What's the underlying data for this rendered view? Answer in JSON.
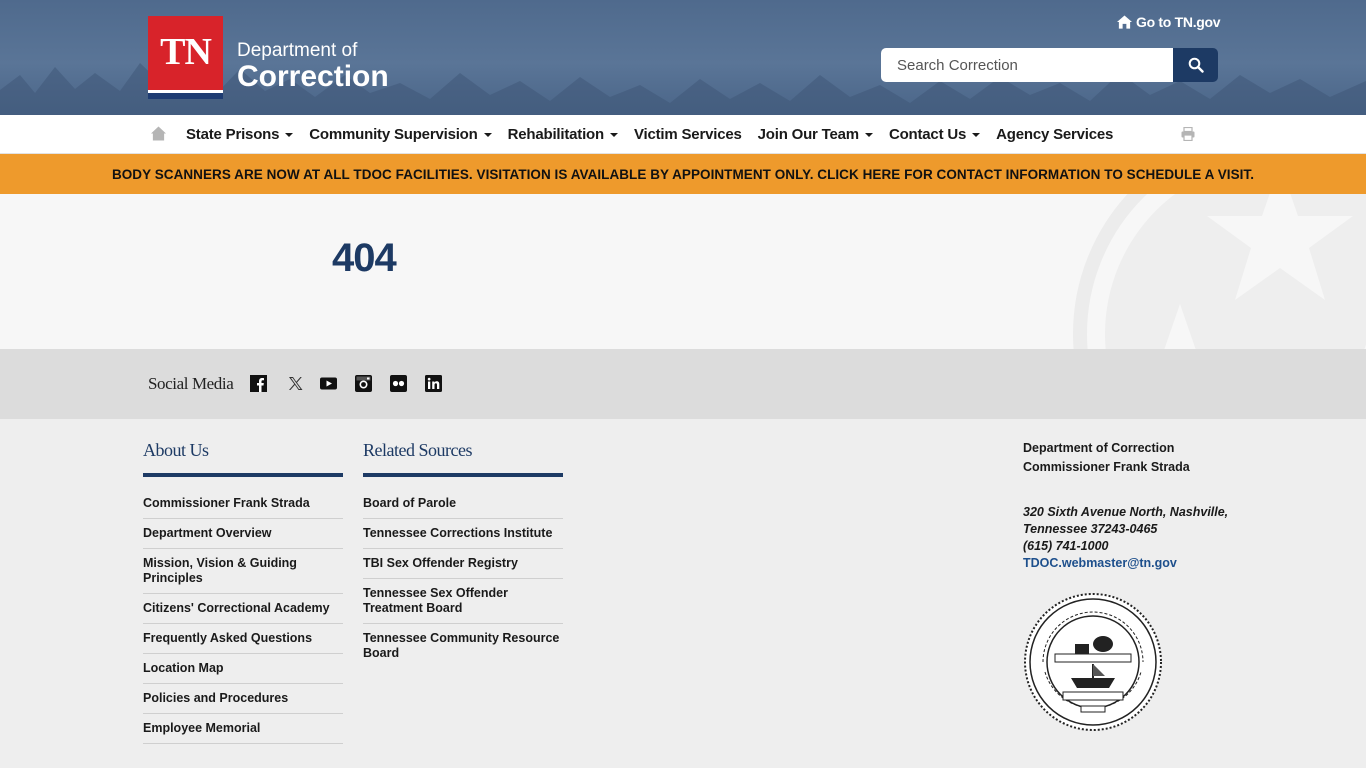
{
  "header": {
    "logo_tn": "TN",
    "dept_line1": "Department of",
    "dept_line2": "Correction",
    "go_to": "Go to TN.gov",
    "search_placeholder": "Search Correction"
  },
  "nav": {
    "items": [
      {
        "label": "State Prisons",
        "dropdown": true
      },
      {
        "label": "Community Supervision",
        "dropdown": true
      },
      {
        "label": "Rehabilitation",
        "dropdown": true
      },
      {
        "label": "Victim Services",
        "dropdown": false
      },
      {
        "label": "Join Our Team",
        "dropdown": true
      },
      {
        "label": "Contact Us",
        "dropdown": true
      },
      {
        "label": "Agency Services",
        "dropdown": false
      }
    ]
  },
  "alert": {
    "text": "BODY SCANNERS ARE NOW AT ALL TDOC FACILITIES. VISITATION IS AVAILABLE BY APPOINTMENT ONLY. CLICK HERE FOR CONTACT INFORMATION TO SCHEDULE A VISIT."
  },
  "main": {
    "heading": "404"
  },
  "social": {
    "title": "Social Media",
    "icons": [
      "facebook-icon",
      "x-icon",
      "youtube-icon",
      "instagram-icon",
      "flickr-icon",
      "linkedin-icon"
    ]
  },
  "footer": {
    "about": {
      "title": "About Us",
      "links": [
        "Commissioner Frank Strada",
        "Department Overview",
        "Mission, Vision & Guiding Principles",
        "Citizens' Correctional Academy",
        "Frequently Asked Questions",
        "Location Map",
        "Policies and Procedures",
        "Employee Memorial"
      ]
    },
    "related": {
      "title": "Related Sources",
      "links": [
        "Board of Parole",
        "Tennessee Corrections Institute",
        "TBI Sex Offender Registry",
        "Tennessee Sex Offender Treatment Board",
        "Tennessee Community Resource Board"
      ]
    },
    "contact": {
      "dept": "Department of Correction",
      "commissioner": "Commissioner Frank Strada",
      "address1": "320 Sixth Avenue North, Nashville,",
      "address2": "Tennessee 37243-0465",
      "phone": "(615) 741-1000",
      "email": "TDOC.webmaster@tn.gov"
    }
  },
  "colors": {
    "navy": "#1d3a64",
    "alert_orange": "#ee9a2c",
    "tn_red": "#d8232a"
  }
}
